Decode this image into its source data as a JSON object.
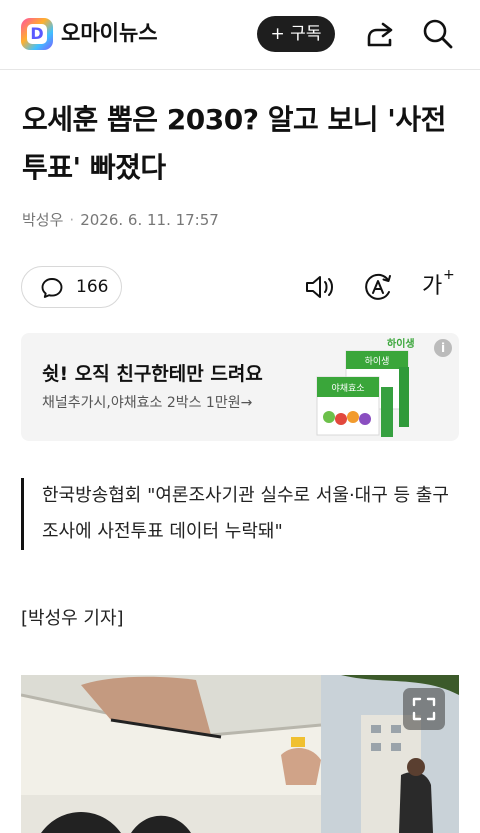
{
  "app": {
    "logo_letter": "D",
    "name": "오마이뉴스"
  },
  "header": {
    "subscribe_label": "+ 구독",
    "share_icon": "share-icon",
    "search_icon": "search-icon"
  },
  "article": {
    "title": "오세훈 뽑은 2030? 알고 보니 '사전투표' 빠졌다",
    "author": "박성우",
    "date": "2026. 6. 11. 17:57",
    "comment_count": "166",
    "font_size_label": "가",
    "quote": "한국방송협회 \"여론조사기관 실수로 서울·대구 등 출구조사에 사전투표 데이터 누락돼\"",
    "reporter": "[박성우 기자]"
  },
  "ad": {
    "title": "쉿! 오직 친구한테만 드려요",
    "subtitle": "채널추가시,야채효소 2박스 1만원→",
    "info": "i",
    "brand": "하이생",
    "box_label_1": "하이생",
    "box_label_2": "야채효소",
    "accent": "#3aa63a"
  },
  "colors": {
    "dark_button": "#1e1e1e",
    "ad_bg": "#f4f4f4"
  }
}
